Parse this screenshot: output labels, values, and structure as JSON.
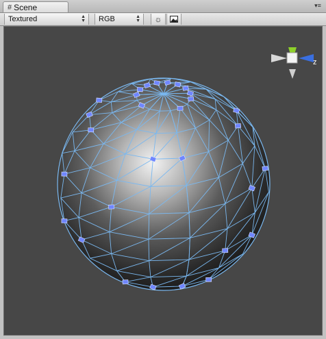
{
  "window": {
    "tab_title": "Scene",
    "tab_icon": "grid-icon",
    "menu_icon": "panel-menu-icon"
  },
  "toolbar": {
    "render_mode": "Textured",
    "color_mode": "RGB",
    "lighting_icon": "sun-icon",
    "image_icon": "image-icon"
  },
  "gizmo": {
    "axis_label": "z",
    "colors": {
      "y": "#8ed02a",
      "z": "#3a6fe0",
      "x": "#d9d9d9"
    }
  },
  "scene": {
    "background": "#474747",
    "wireframe_color": "#7ab8f0",
    "handle_color": "#6f86ff"
  }
}
